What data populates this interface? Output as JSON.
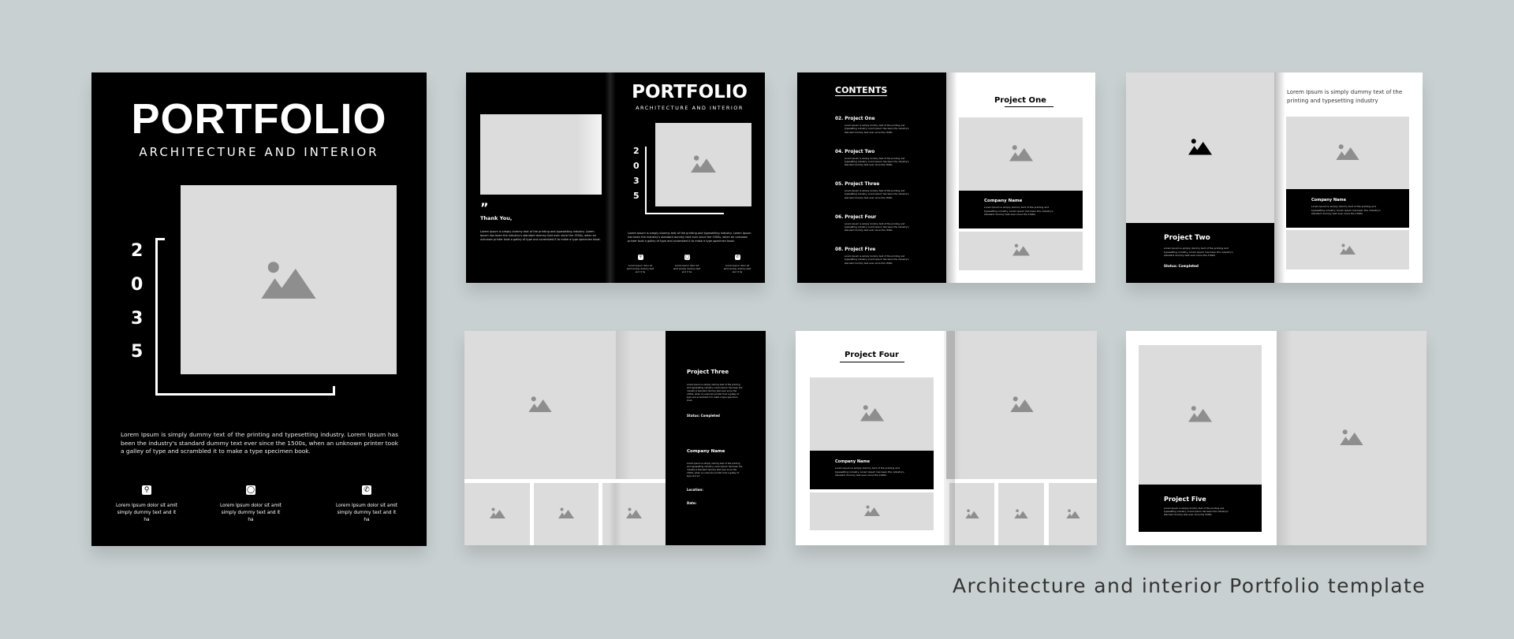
{
  "cover": {
    "title": "PORTFOLIO",
    "subtitle": "ARCHITECTURE AND INTERIOR",
    "year_digits": [
      "2",
      "0",
      "3",
      "5"
    ],
    "paragraph": "Lorem Ipsum is simply dummy text of the printing and typesetting industry. Lorem Ipsum has been the industry's standard dummy text ever since the 1500s, when an unknown printer took a galley of type and scrambled it to make a type specimen book.",
    "contacts": [
      {
        "icon": "location-pin-icon",
        "line1": "Lorem Ipsum dolor sit amit",
        "line2": "simply dummy text and it ha"
      },
      {
        "icon": "globe-icon",
        "line1": "Lorem Ipsum dolor sit amit",
        "line2": "simply dummy text and it ha"
      },
      {
        "icon": "phone-icon",
        "line1": "Lorem Ipsum dolor sit amit",
        "line2": "simply dummy text and it ha"
      }
    ]
  },
  "spread1": {
    "quote_mark": "”",
    "thanks": "Thank You,",
    "paragraph": "Lorem Ipsum is simply dummy text of the printing and typesetting industry. Lorem Ipsum has been the industry's standard dummy text ever since the 1500s, when an unknown printer took a galley of type and scrambled it to make a type specimen book.",
    "title": "PORTFOLIO",
    "subtitle": "ARCHITECTURE AND INTERIOR",
    "year_digits": [
      "2",
      "0",
      "3",
      "5"
    ],
    "contact_text": "Lorem Ipsum dolor sit amit simply dummy text and it ha"
  },
  "spread2": {
    "contents_title": "CONTENTS",
    "items": [
      {
        "label": "02. Project One"
      },
      {
        "label": "04. Project Two"
      },
      {
        "label": "05. Project Three"
      },
      {
        "label": "06. Project Four"
      },
      {
        "label": "08. Project Five"
      }
    ],
    "item_desc": "Lorem Ipsum is simply dummy text of the printing and typesetting industry. Lorem Ipsum has been the industry's standard dummy text ever since the 1500s",
    "project_title": "Project One",
    "company": "Company Name",
    "company_desc": "Lorem Ipsum is simply dummy text of the printing and typesetting industry. Lorem Ipsum has been the industry's standard dummy text ever since the 1500s"
  },
  "spread3": {
    "project_title": "Project Two",
    "desc": "Lorem Ipsum is simply dummy text of the printing and typesetting industry. Lorem Ipsum has been the industry's standard dummy text ever since the 1500s",
    "status": "Status: Completed",
    "headline": "Lorem Ipsum is simply dummy text of the printing and typesetting industry",
    "company": "Company Name",
    "company_desc": "Lorem Ipsum is simply dummy text of the printing and typesetting industry. Lorem Ipsum has been the industry's standard dummy text ever since the 1500s"
  },
  "spread4": {
    "project_title": "Project Three",
    "desc": "Lorem Ipsum is simply dummy text of the printing and typesetting industry. Lorem Ipsum has been the industry's standard dummy text ever since the 1500s, when an unknown printer took a galley of type and scrambled it to make a type specimen book.",
    "status": "Status: Completed",
    "company": "Company Name",
    "company_desc": "Lorem Ipsum is simply dummy text of the printing and typesetting industry. Lorem Ipsum has been the industry's standard dummy text ever since the 1500s, when an unknown printer took a galley of type and scr",
    "location": "Location:",
    "date": "Date:"
  },
  "spread5": {
    "project_title": "Project Four",
    "company": "Company Name",
    "company_desc": "Lorem Ipsum is simply dummy text of the printing and typesetting industry. Lorem Ipsum has been the industry's standard dummy text ever since the 1500s"
  },
  "spread6": {
    "project_title": "Project Five",
    "desc": "Lorem Ipsum is simply dummy text of the printing and typesetting industry. Lorem Ipsum has been the industry's standard dummy text ever since the 1500s"
  },
  "caption": "Architecture and interior Portfolio template",
  "colors": {
    "background": "#c9d0d1",
    "page_black": "#000000",
    "placeholder": "#dcdcdc",
    "placeholder_icon": "#8e8e8e"
  }
}
